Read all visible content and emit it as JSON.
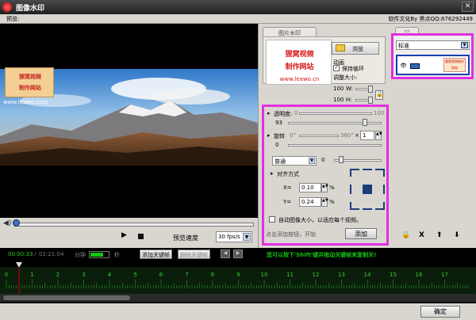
{
  "window": {
    "title": "图像水印",
    "close": "✕"
  },
  "menu": {
    "preview": "预览:",
    "credits": "软件文化By 黑点QQ:876292449"
  },
  "video": {
    "watermark_line1": "狸窝视频",
    "watermark_line2": "制作网站",
    "url": "www.leawo.com",
    "seek_progress": 0.0
  },
  "controls": {
    "speed_label": "预览速度",
    "speed_value": "30 fps/s",
    "play": "▶"
  },
  "panel": {
    "tab_image": "图片水印",
    "logo": {
      "line1": "狸窝视频",
      "line2": "制作网站",
      "url": "www.leawo.cn"
    },
    "browse": "浏览",
    "animation_label": "动画",
    "loop_label": "保持循环",
    "resize_label": "调整大小:",
    "width_label": "W:",
    "width_value": "100",
    "height_label": "H:",
    "height_value": "100"
  },
  "settings": {
    "opacity_label": "透明度:",
    "opacity_min": "0",
    "opacity_max": "100",
    "opacity_value": "93",
    "rotation_label": "旋转",
    "rotation_min": "0°",
    "rotation_max": "360°",
    "rotation_x": "×",
    "rotation_step": "1",
    "rotation_value": "0",
    "blend_mode": "普通",
    "blend_value": "0",
    "align_label": "对齐方式",
    "x_label": "X=",
    "x_value": "0.10",
    "x_unit": "%",
    "y_label": "Y=",
    "y_value": "0.24",
    "y_unit": "%",
    "auto_size_label": "自动图像大小，以适应每个视频。",
    "hint": "点击添加按钮，开始",
    "add_button": "添加"
  },
  "right": {
    "preset": "标准",
    "item_text": "狸窝视频制作网站",
    "buttons": [
      "🔒",
      "X",
      "⬆",
      "⬇"
    ]
  },
  "timeline": {
    "current_time": "00:00:33",
    "total_time": "02:21:04",
    "minute_label": "分钟",
    "second_label": "秒",
    "add_keyframe": "添加关键帧",
    "delete_keyframe": "删除关键帧",
    "tip": "您可以按下'Shift'键并拖动关键帧来复制关!",
    "ruler": [
      "0",
      "1",
      "2",
      "3",
      "4",
      "5",
      "6",
      "7",
      "8",
      "9",
      "10",
      "11",
      "12",
      "13",
      "14",
      "15",
      "16",
      "17"
    ],
    "playhead_position": 0.5
  },
  "footer": {
    "ok": "确定"
  },
  "colors": {
    "highlight": "#e32fe0",
    "accent_green": "#12c212",
    "title_bg": "#2a2a2a"
  }
}
